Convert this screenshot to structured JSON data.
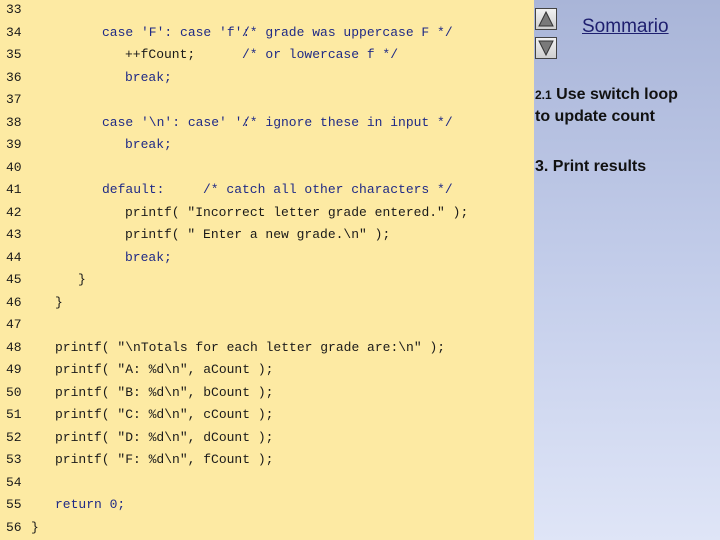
{
  "code_lines": [
    {
      "num": "33",
      "segments": []
    },
    {
      "num": "34",
      "segments": [
        {
          "text": "case 'F': case 'f':",
          "col": 13,
          "style": "kw"
        },
        {
          "text": "/* grade was uppercase F */",
          "col": 31,
          "style": "cmt"
        }
      ]
    },
    {
      "num": "35",
      "segments": [
        {
          "text": "++fCount;",
          "col": 16,
          "style": ""
        },
        {
          "text": "/* or lowercase f */",
          "col": 31,
          "style": "cmt"
        }
      ]
    },
    {
      "num": "36",
      "segments": [
        {
          "text": "break;",
          "col": 16,
          "style": "kw"
        }
      ]
    },
    {
      "num": "37",
      "segments": []
    },
    {
      "num": "38",
      "segments": [
        {
          "text": "case '\\n': case' ':",
          "col": 13,
          "style": "kw"
        },
        {
          "text": "/* ignore these in input */",
          "col": 31,
          "style": "cmt"
        }
      ]
    },
    {
      "num": "39",
      "segments": [
        {
          "text": "break;",
          "col": 16,
          "style": "kw"
        }
      ]
    },
    {
      "num": "40",
      "segments": []
    },
    {
      "num": "41",
      "segments": [
        {
          "text": "default:",
          "col": 13,
          "style": "kw"
        },
        {
          "text": "/* catch all other characters */",
          "col": 26,
          "style": "cmt"
        }
      ]
    },
    {
      "num": "42",
      "segments": [
        {
          "text": "printf( \"Incorrect letter grade entered.\" );",
          "col": 16,
          "style": ""
        }
      ]
    },
    {
      "num": "43",
      "segments": [
        {
          "text": "printf( \" Enter a new grade.\\n\" );",
          "col": 16,
          "style": ""
        }
      ]
    },
    {
      "num": "44",
      "segments": [
        {
          "text": "break;",
          "col": 16,
          "style": "kw"
        }
      ]
    },
    {
      "num": "45",
      "segments": [
        {
          "text": "}",
          "col": 10,
          "style": ""
        }
      ]
    },
    {
      "num": "46",
      "segments": [
        {
          "text": "}",
          "col": 7,
          "style": ""
        }
      ]
    },
    {
      "num": "47",
      "segments": []
    },
    {
      "num": "48",
      "segments": [
        {
          "text": "printf( \"\\nTotals for each letter grade are:\\n\" );",
          "col": 7,
          "style": ""
        }
      ]
    },
    {
      "num": "49",
      "segments": [
        {
          "text": "printf( \"A: %d\\n\", aCount );",
          "col": 7,
          "style": ""
        }
      ]
    },
    {
      "num": "50",
      "segments": [
        {
          "text": "printf( \"B: %d\\n\", bCount );",
          "col": 7,
          "style": ""
        }
      ]
    },
    {
      "num": "51",
      "segments": [
        {
          "text": "printf( \"C: %d\\n\", cCount );",
          "col": 7,
          "style": ""
        }
      ]
    },
    {
      "num": "52",
      "segments": [
        {
          "text": "printf( \"D: %d\\n\", dCount );",
          "col": 7,
          "style": ""
        }
      ]
    },
    {
      "num": "53",
      "segments": [
        {
          "text": "printf( \"F: %d\\n\", fCount );",
          "col": 7,
          "style": ""
        }
      ]
    },
    {
      "num": "54",
      "segments": []
    },
    {
      "num": "55",
      "segments": [
        {
          "text": "return 0;",
          "col": 7,
          "style": "kw"
        }
      ]
    },
    {
      "num": "56",
      "segments": [
        {
          "text": "}",
          "col": 4,
          "style": ""
        }
      ]
    }
  ],
  "sidebar": {
    "up_icon": "triangle-up-icon",
    "down_icon": "triangle-down-icon",
    "sommario_label": "Sommario",
    "step1_prefix": "2.1",
    "step1_line1": "Use switch loop",
    "step1_line2": "to update count",
    "step2": "3.  Print results"
  },
  "colors": {
    "code_background": "#fdeaa3",
    "sidebar_gradient_top": "#a9b5d8",
    "sidebar_gradient_bottom": "#dfe5f7",
    "comment_color": "#1f2a86",
    "link_color": "#1e1f6f"
  }
}
